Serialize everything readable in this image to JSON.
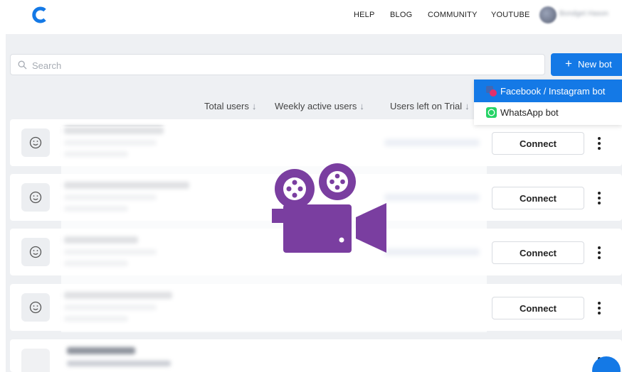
{
  "nav": {
    "links": [
      "HELP",
      "BLOG",
      "COMMUNITY",
      "YOUTUBE"
    ],
    "user_name": "Bondget Hason"
  },
  "search": {
    "placeholder": "Search",
    "value": ""
  },
  "new_bot": {
    "label": "New bot",
    "plus": "+"
  },
  "columns": [
    "Total users",
    "Weekly active users",
    "Users left on Trial"
  ],
  "dropdown": {
    "items": [
      {
        "label": "Facebook / Instagram bot",
        "icon": "facebook-instagram-icon",
        "active": true
      },
      {
        "label": "WhatsApp bot",
        "icon": "whatsapp-icon",
        "active": false
      }
    ]
  },
  "rows": [
    {
      "connect_label": "Connect"
    },
    {
      "connect_label": "Connect"
    },
    {
      "connect_label": "Connect"
    },
    {
      "connect_label": "Connect"
    }
  ],
  "colors": {
    "accent": "#1479e6",
    "camera": "#7a3ea0",
    "background": "#eef0f3"
  }
}
